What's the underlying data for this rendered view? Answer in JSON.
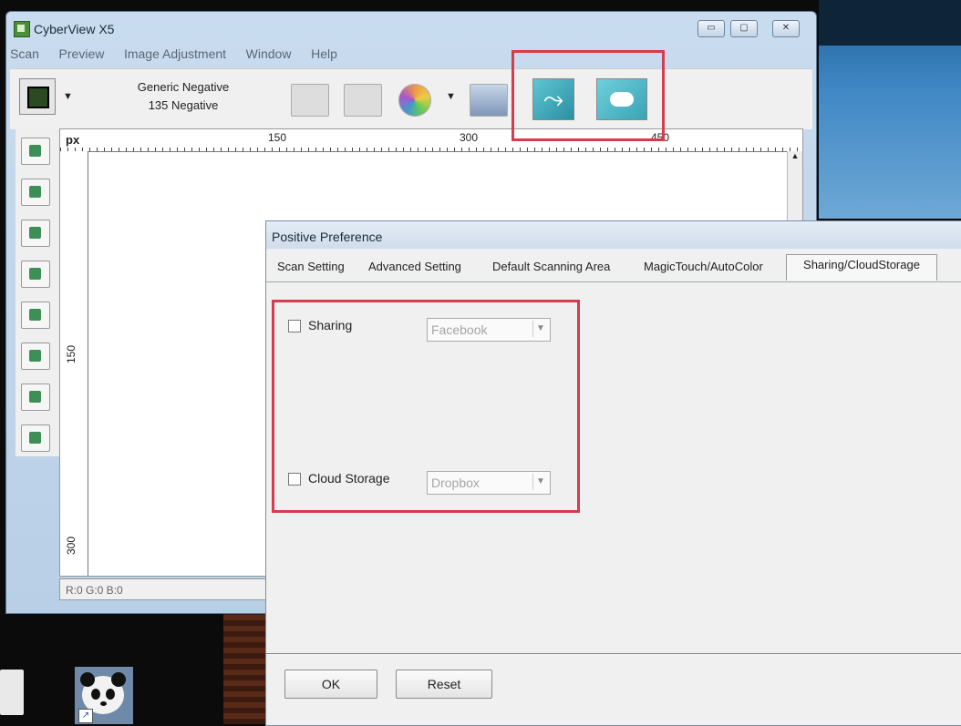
{
  "window": {
    "title": "CyberView X5",
    "controls": [
      "▭",
      "▢",
      "✕"
    ]
  },
  "menu": [
    "Scan",
    "Preview",
    "Image Adjustment",
    "Window",
    "Help"
  ],
  "toolbar": {
    "film_type": "Generic Negative",
    "film_format": "135 Negative",
    "caret": "▼"
  },
  "ruler": {
    "unit": "px",
    "top_ticks": [
      "150",
      "300",
      "450"
    ],
    "left_ticks": [
      "150",
      "300"
    ]
  },
  "status": {
    "rgb": "R:0 G:0 B:0"
  },
  "dialog": {
    "title": "Positive Preference",
    "tabs": [
      "Scan Setting",
      "Advanced Setting",
      "Default Scanning Area",
      "MagicTouch/AutoColor",
      "Sharing/CloudStorage"
    ],
    "sharing_label": "Sharing",
    "sharing_value": "Facebook",
    "cloud_label": "Cloud Storage",
    "cloud_value": "Dropbox",
    "ok_label": "OK",
    "reset_label": "Reset",
    "combo_arrow": "▼"
  },
  "colors": {
    "highlight": "#d33d4d",
    "accent": "#2c8fa2"
  }
}
